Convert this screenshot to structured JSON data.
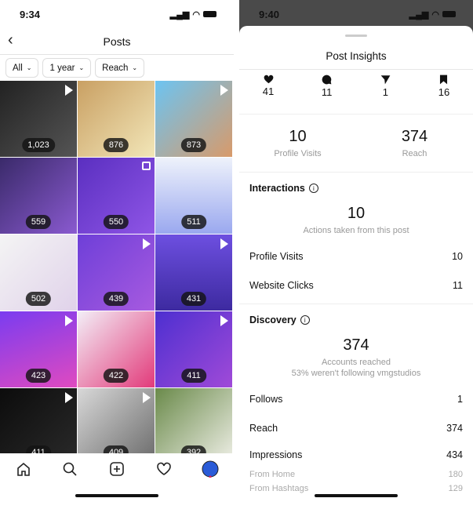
{
  "left": {
    "status_time": "9:34",
    "title": "Posts",
    "filters": [
      {
        "label": "All"
      },
      {
        "label": "1 year"
      },
      {
        "label": "Reach"
      }
    ],
    "posts": [
      {
        "count": "1,023",
        "type": "video",
        "bg": "linear-gradient(135deg,#222,#555)"
      },
      {
        "count": "876",
        "type": "photo",
        "bg": "linear-gradient(135deg,#c9a063,#f2e6b8)"
      },
      {
        "count": "873",
        "type": "video",
        "bg": "linear-gradient(135deg,#6cc4f2,#d89a6a)"
      },
      {
        "count": "559",
        "type": "photo",
        "bg": "linear-gradient(135deg,#3a2a6a,#8a5ad0)"
      },
      {
        "count": "550",
        "type": "carousel",
        "bg": "linear-gradient(135deg,#5a2fc0,#8f55e6)"
      },
      {
        "count": "511",
        "type": "photo",
        "bg": "linear-gradient(180deg,#eef2fb,#9aa8ef)"
      },
      {
        "count": "502",
        "type": "photo",
        "bg": "linear-gradient(135deg,#f4f4f4,#e0d2ea)"
      },
      {
        "count": "439",
        "type": "video",
        "bg": "linear-gradient(135deg,#6e3fd8,#a75ae0)"
      },
      {
        "count": "431",
        "type": "video",
        "bg": "linear-gradient(180deg,#6d4fe0,#3d2aa0)"
      },
      {
        "count": "423",
        "type": "video",
        "bg": "linear-gradient(160deg,#7a3cf0,#e04ac0)"
      },
      {
        "count": "422",
        "type": "photo",
        "bg": "linear-gradient(135deg,#f3eef7,#e23a7a)"
      },
      {
        "count": "411",
        "type": "video",
        "bg": "linear-gradient(135deg,#4d2fd0,#a04ad8)"
      },
      {
        "count": "411",
        "type": "video",
        "bg": "linear-gradient(135deg,#0c0c0c,#2a2a2a)"
      },
      {
        "count": "409",
        "type": "video",
        "bg": "linear-gradient(135deg,#d8d8d8,#6a6a6a)"
      },
      {
        "count": "392",
        "type": "photo",
        "bg": "linear-gradient(135deg,#6a8a4a,#f0f0e8)"
      }
    ],
    "tabs": [
      "home-icon",
      "search-icon",
      "add-post-icon",
      "heart-icon",
      "profile-icon"
    ]
  },
  "right": {
    "status_time": "9:40",
    "title": "Post Insights",
    "engagement": [
      {
        "icon": "heart-icon",
        "value": "41"
      },
      {
        "icon": "comment-icon",
        "value": "11"
      },
      {
        "icon": "share-icon",
        "value": "1"
      },
      {
        "icon": "bookmark-icon",
        "value": "16"
      }
    ],
    "summary": [
      {
        "value": "10",
        "label": "Profile Visits"
      },
      {
        "value": "374",
        "label": "Reach"
      }
    ],
    "interactions": {
      "heading": "Interactions",
      "value": "10",
      "caption": "Actions taken from this post",
      "rows": [
        {
          "label": "Profile Visits",
          "value": "10"
        },
        {
          "label": "Website Clicks",
          "value": "11"
        }
      ]
    },
    "discovery": {
      "heading": "Discovery",
      "value": "374",
      "caption": "Accounts reached",
      "caption2": "53% weren't following vmgstudios",
      "rows": [
        {
          "label": "Follows",
          "value": "1"
        },
        {
          "label": "Reach",
          "value": "374"
        }
      ],
      "impressions": {
        "label": "Impressions",
        "value": "434"
      },
      "sub_rows": [
        {
          "label": "From Home",
          "value": "180"
        },
        {
          "label": "From Hashtags",
          "value": "129"
        }
      ]
    }
  }
}
